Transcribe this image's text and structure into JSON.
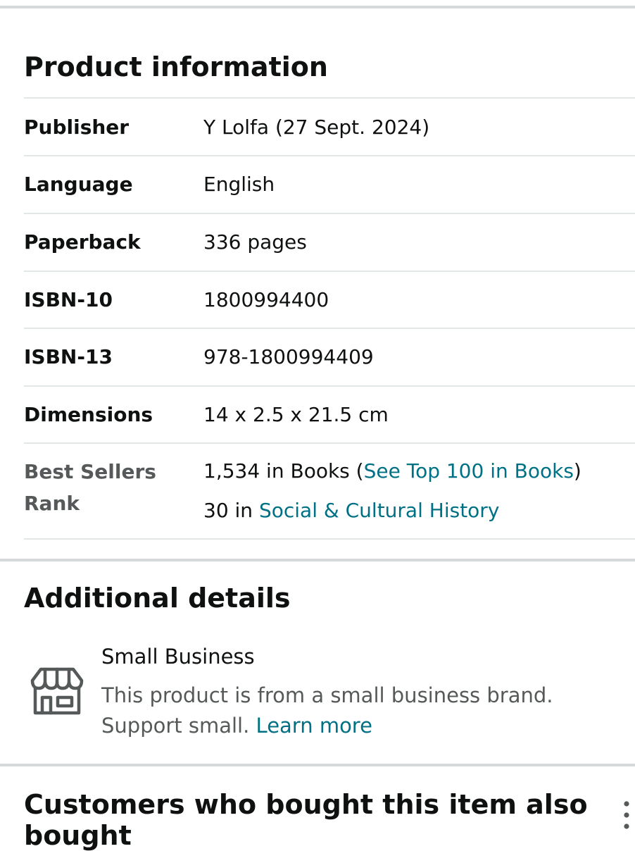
{
  "product_information": {
    "title": "Product information",
    "rows": [
      {
        "label": "Publisher",
        "value": "Y Lolfa (27 Sept. 2024)"
      },
      {
        "label": "Language",
        "value": "English"
      },
      {
        "label": "Paperback",
        "value": "336 pages"
      },
      {
        "label": "ISBN-10",
        "value": "1800994400"
      },
      {
        "label": "ISBN-13",
        "value": "978-1800994409"
      },
      {
        "label": "Dimensions",
        "value": "14 x 2.5 x 21.5 cm"
      }
    ],
    "best_sellers_rank": {
      "label": "Best Sellers Rank",
      "line1_prefix": "1,534 in Books (",
      "line1_link": "See Top 100 in Books",
      "line1_suffix": ")",
      "line2_prefix": "30 in ",
      "line2_link": "Social & Cultural History"
    }
  },
  "additional_details": {
    "title": "Additional details",
    "small_business": {
      "icon": "storefront-icon",
      "title": "Small Business",
      "description": "This product is from a small business brand. Support small.",
      "link": "Learn more"
    }
  },
  "also_bought": {
    "title": "Customers who bought this item also bought",
    "menu_icon": "more-vertical-icon"
  },
  "colors": {
    "link": "#007185",
    "text": "#0f1111",
    "muted": "#565959",
    "divider": "#d5d9d9"
  }
}
